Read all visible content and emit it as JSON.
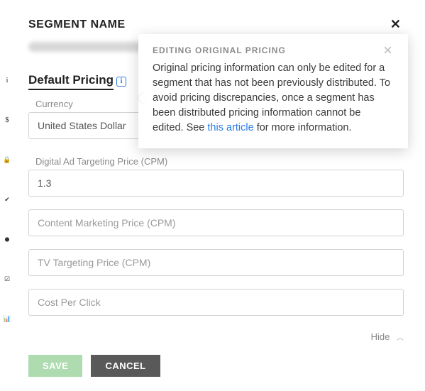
{
  "rail": {
    "icons": [
      "i",
      "$",
      "🔒",
      "✔",
      "⬤",
      "☑",
      "📊"
    ]
  },
  "header": {
    "title": "SEGMENT NAME"
  },
  "section": {
    "title": "Default Pricing",
    "info_glyph": "i"
  },
  "fields": {
    "currency": {
      "label": "Currency",
      "value": "United States Dollar"
    },
    "digital": {
      "label": "Digital Ad Targeting Price (CPM)",
      "value": "1.3"
    },
    "content": {
      "label": "",
      "placeholder": "Content Marketing Price (CPM)",
      "value": ""
    },
    "tv": {
      "label": "",
      "placeholder": "TV Targeting Price (CPM)",
      "value": ""
    },
    "cpc": {
      "label": "",
      "placeholder": "Cost Per Click",
      "value": ""
    }
  },
  "hide": {
    "label": "Hide"
  },
  "buttons": {
    "save": "SAVE",
    "cancel": "CANCEL"
  },
  "tooltip": {
    "title": "EDITING ORIGINAL PRICING",
    "body_pre": "Original pricing information can only be edited for a segment that has not been previously distributed. To avoid pricing discrepancies, once a segment has been distributed pricing information cannot be edited. See ",
    "link_text": "this article",
    "body_post": " for more information."
  }
}
